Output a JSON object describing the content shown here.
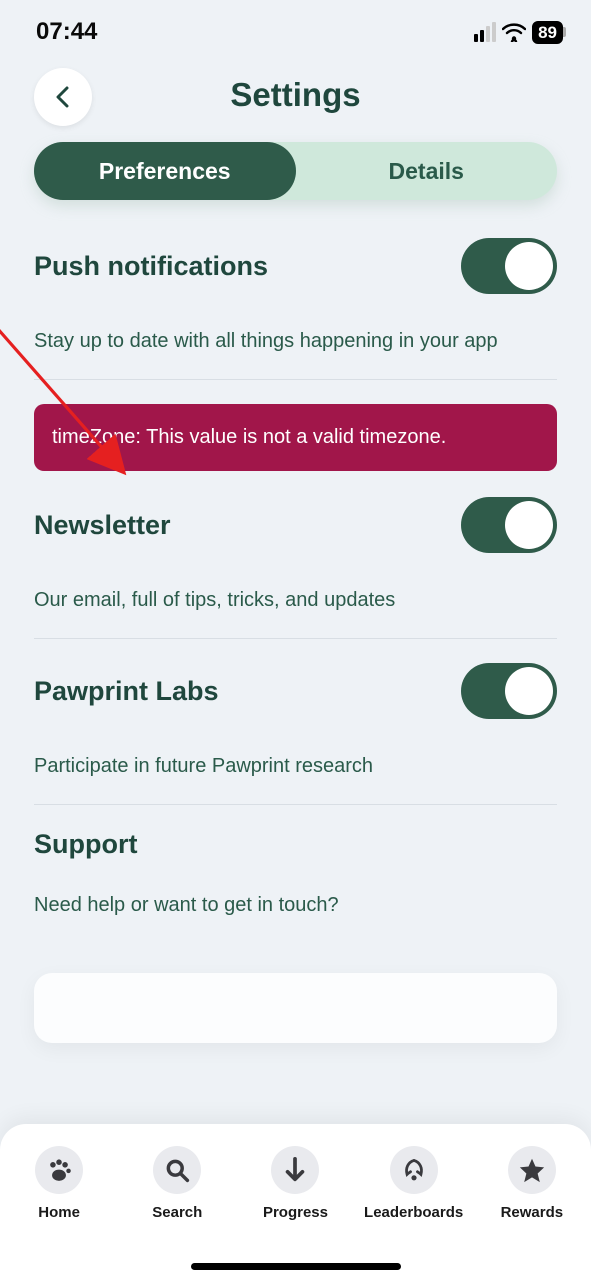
{
  "status": {
    "time": "07:44",
    "battery": "89"
  },
  "header": {
    "title": "Settings"
  },
  "tabs": {
    "preferences": "Preferences",
    "details": "Details"
  },
  "push": {
    "title": "Push notifications",
    "desc": "Stay up to date with all things happening in your app",
    "on": true
  },
  "error": {
    "message": "timeZone: This value is not a valid timezone."
  },
  "newsletter": {
    "title": "Newsletter",
    "desc": "Our email, full of tips, tricks, and updates",
    "on": true
  },
  "labs": {
    "title": "Pawprint Labs",
    "desc": "Participate in future Pawprint research",
    "on": true
  },
  "support": {
    "title": "Support",
    "desc": "Need help or want to get in touch?"
  },
  "nav": {
    "home": "Home",
    "search": "Search",
    "progress": "Progress",
    "leaderboards": "Leaderboards",
    "rewards": "Rewards"
  },
  "colors": {
    "accent": "#2f5b4a",
    "accentLight": "#cfe8db",
    "text": "#1f473d",
    "textSub": "#2a5a4a",
    "error": "#a1164a",
    "bg": "#eef2f6"
  }
}
